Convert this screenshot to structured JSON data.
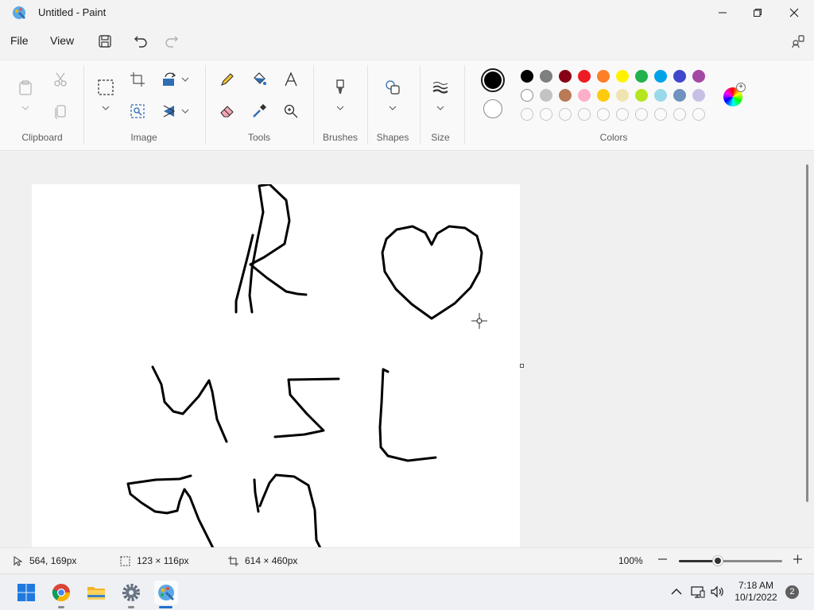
{
  "window": {
    "title": "Untitled - Paint",
    "colors": {
      "titlebar_bg": "#f3f3f3",
      "ribbon_bg": "#f9f9f9",
      "canvas_bg": "#ffffff",
      "workspace_bg": "#f0f0f0"
    }
  },
  "menu": {
    "file_label": "File",
    "view_label": "View",
    "icons": [
      "save-icon",
      "undo-icon",
      "redo-icon",
      "share-icon"
    ]
  },
  "ribbon": {
    "groups": [
      {
        "label": "Clipboard",
        "tools": [
          "paste-icon",
          "cut-icon",
          "copy-icon"
        ]
      },
      {
        "label": "Image",
        "tools": [
          "select-icon",
          "crop-icon",
          "resize-icon",
          "rotate-icon",
          "flip-icon",
          "image-search-icon"
        ]
      },
      {
        "label": "Tools",
        "tools": [
          "pencil-icon",
          "fill-icon",
          "text-icon",
          "eraser-icon",
          "color-picker-icon",
          "magnifier-icon"
        ]
      },
      {
        "label": "Brushes",
        "tools": [
          "brush-icon"
        ]
      },
      {
        "label": "Shapes",
        "tools": [
          "shapes-icon"
        ]
      },
      {
        "label": "Size",
        "tools": [
          "size-icon"
        ]
      },
      {
        "label": "Colors",
        "tools": [
          "palette"
        ]
      }
    ],
    "colors": {
      "primary": "#000000",
      "secondary": "#ffffff",
      "row1": [
        "#000000",
        "#7f7f7f",
        "#880015",
        "#ed1c24",
        "#ff7f27",
        "#fff200",
        "#22b14c",
        "#00a2e8",
        "#3f48cc",
        "#a349a4"
      ],
      "row2": [
        "#ffffff",
        "#c3c3c3",
        "#b97a57",
        "#ffaec9",
        "#ffc90e",
        "#efe4b0",
        "#b5e61d",
        "#99d9ea",
        "#7092be",
        "#c8bfe7"
      ],
      "row3": [
        "empty",
        "empty",
        "empty",
        "empty",
        "empty",
        "empty",
        "empty",
        "empty",
        "empty",
        "empty"
      ]
    }
  },
  "status": {
    "cursor_position": "564, 169px",
    "selection_size": "123 × 116px",
    "canvas_size": "614 × 460px",
    "zoom": "100%",
    "zoom_level_fraction": 0.38
  },
  "taskbar": {
    "apps": [
      "start-icon",
      "chrome-icon",
      "file-explorer-icon",
      "settings-icon",
      "paint-icon"
    ],
    "time": "7:18 AM",
    "date": "10/1/2022",
    "notification_count": "2"
  }
}
